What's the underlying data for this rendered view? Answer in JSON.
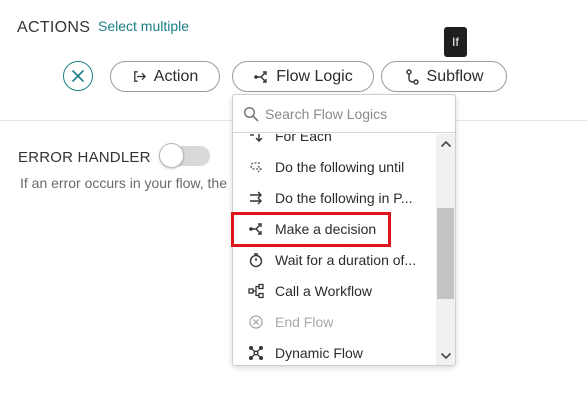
{
  "header": {
    "title": "ACTIONS",
    "select_multiple": "Select multiple"
  },
  "tooltip": {
    "text": "If"
  },
  "buttons": {
    "close_icon": "close-icon",
    "action": {
      "label": "Action",
      "icon": "action-arrow-icon"
    },
    "flow_logic": {
      "label": "Flow Logic",
      "icon": "flow-logic-icon"
    },
    "subflow": {
      "label": "Subflow",
      "icon": "subflow-icon"
    }
  },
  "dropdown": {
    "search_placeholder": "Search Flow Logics",
    "items": [
      {
        "label": "For Each",
        "icon": "for-each-icon",
        "disabled": false
      },
      {
        "label": "Do the following until",
        "icon": "loop-until-icon",
        "disabled": false
      },
      {
        "label": "Do the following in P...",
        "icon": "parallel-icon",
        "disabled": false
      },
      {
        "label": "Make a decision",
        "icon": "decision-icon",
        "disabled": false,
        "highlighted": true
      },
      {
        "label": "Wait for a duration of...",
        "icon": "timer-icon",
        "disabled": false
      },
      {
        "label": "Call a Workflow",
        "icon": "workflow-icon",
        "disabled": false
      },
      {
        "label": "End Flow",
        "icon": "end-flow-icon",
        "disabled": true
      },
      {
        "label": "Dynamic Flow",
        "icon": "dynamic-flow-icon",
        "disabled": false
      }
    ]
  },
  "error_handler": {
    "title": "ERROR HANDLER",
    "enabled": false,
    "description": "If an error occurs in your flow, the"
  },
  "colors": {
    "accent": "#1b7f86",
    "highlight": "#e0141b"
  }
}
